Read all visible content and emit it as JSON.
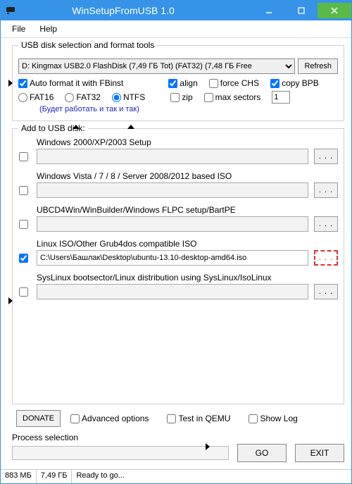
{
  "window": {
    "title": "WinSetupFromUSB 1.0"
  },
  "menu": {
    "file": "File",
    "help": "Help"
  },
  "usbgroup": {
    "title": "USB disk selection and format tools",
    "drive": "D: Kingmax USB2.0 FlashDisk (7,49 ГБ Tot) (FAT32) (7,48 ГБ Free",
    "refresh": "Refresh",
    "autoformat": "Auto format it with FBinst",
    "fat16": "FAT16",
    "fat32": "FAT32",
    "ntfs": "NTFS",
    "align": "align",
    "forcechs": "force CHS",
    "copybpb": "copy BPB",
    "zip": "zip",
    "maxsectors": "max sectors",
    "maxsectors_val": "1",
    "annotation": "(Будет работать и так и так)"
  },
  "addgroup": {
    "title": "Add to USB disk:",
    "e1": "Windows 2000/XP/2003 Setup",
    "e2": "Windows Vista / 7 / 8 / Server 2008/2012 based ISO",
    "e3": "UBCD4Win/WinBuilder/Windows FLPC setup/BartPE",
    "e4": "Linux ISO/Other Grub4dos compatible ISO",
    "e4path": "C:\\Users\\Башлак\\Desktop\\ubuntu-13.10-desktop-amd64.iso",
    "e5": "SysLinux bootsector/Linux distribution using SysLinux/IsoLinux",
    "browse": ". . ."
  },
  "bottom": {
    "donate": "DONATE",
    "advanced": "Advanced options",
    "testqemu": "Test in QEMU",
    "showlog": "Show Log",
    "process": "Process selection",
    "go": "GO",
    "exit": "EXIT"
  },
  "status": {
    "s1": "883 МБ",
    "s2": "7,49 ГБ",
    "s3": "Ready to go..."
  }
}
